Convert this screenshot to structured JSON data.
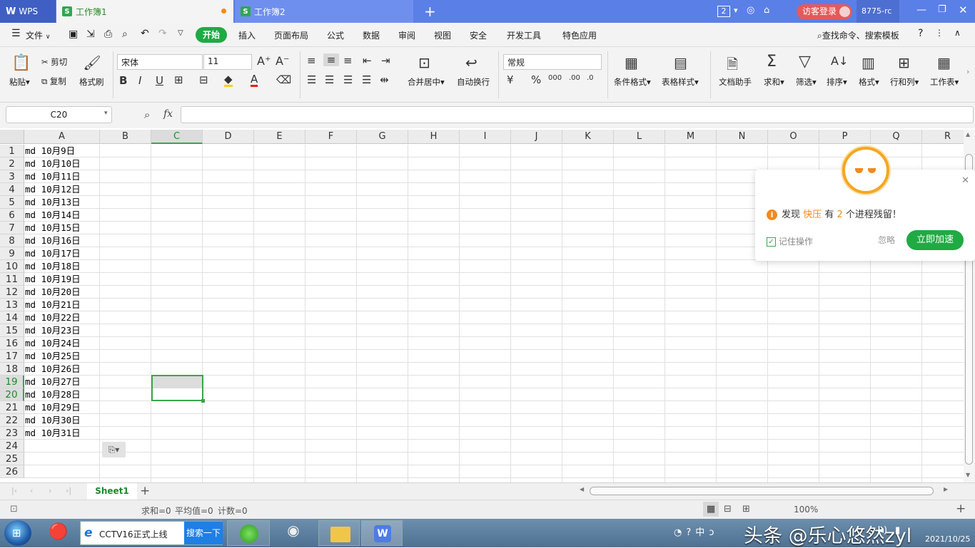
{
  "titlebar": {
    "tabs": [
      {
        "label": "WPS"
      },
      {
        "label": "工作簿1"
      },
      {
        "label": "工作簿2"
      }
    ],
    "badge": "2",
    "login_label": "访客登录",
    "user_id": "8775-rc"
  },
  "menu": {
    "file": "文件",
    "items": [
      "开始",
      "插入",
      "页面布局",
      "公式",
      "数据",
      "审阅",
      "视图",
      "安全",
      "开发工具",
      "特色应用"
    ],
    "search_label": "查找命令、搜索模板"
  },
  "ribbon": {
    "paste": "粘贴",
    "cut": "剪切",
    "copy": "复制",
    "format_painter": "格式刷",
    "font_name": "宋体",
    "font_size": "11",
    "merge_center": "合并居中",
    "wrap_text": "自动换行",
    "number_format": "常规",
    "cond_format": "条件格式",
    "table_style": "表格样式",
    "doc_helper": "文档助手",
    "sum": "求和",
    "filter": "筛选",
    "sort": "排序",
    "format": "格式",
    "rows_cols": "行和列",
    "worksheet": "工作表"
  },
  "formula_bar": {
    "name_box": "C20",
    "fx": "fx",
    "value": ""
  },
  "grid": {
    "columns": [
      "A",
      "B",
      "C",
      "D",
      "E",
      "F",
      "G",
      "H",
      "I",
      "J",
      "K",
      "L",
      "M",
      "N",
      "O",
      "P",
      "Q",
      "R"
    ],
    "rows": [
      "1",
      "2",
      "3",
      "4",
      "5",
      "6",
      "7",
      "8",
      "9",
      "10",
      "11",
      "12",
      "13",
      "14",
      "15",
      "16",
      "17",
      "18",
      "19",
      "20",
      "21",
      "22",
      "23",
      "24",
      "25",
      "26"
    ],
    "col_a": [
      "md 10月9日",
      "md 10月10日",
      "md 10月11日",
      "md 10月12日",
      "md 10月13日",
      "md 10月14日",
      "md 10月15日",
      "md 10月16日",
      "md 10月17日",
      "md 10月18日",
      "md 10月19日",
      "md 10月20日",
      "md 10月21日",
      "md 10月22日",
      "md 10月23日",
      "md 10月24日",
      "md 10月25日",
      "md 10月26日",
      "md 10月27日",
      "md 10月28日",
      "md 10月29日",
      "md 10月30日",
      "md 10月31日"
    ]
  },
  "popup": {
    "msg_prefix": "发现",
    "app_name": "快压",
    "msg_mid": "有",
    "count": "2",
    "msg_suffix": "个进程残留！",
    "remember": "记住操作",
    "ignore": "忽略",
    "accelerate": "立即加速"
  },
  "sheets": {
    "active": "Sheet1"
  },
  "status": {
    "sum": "求和=0",
    "avg": "平均值=0",
    "count": "计数=0",
    "zoom": "100%"
  },
  "taskbar": {
    "ie_label": "CCTV16正式上线",
    "search_btn": "搜索一下",
    "watermark": "头条 @乐心悠然zyl",
    "date": "2021/10/25"
  },
  "colors": {
    "title_blue": "#5a7fe6",
    "accent_green": "#1faa44",
    "popup_orange": "#f08a1c"
  }
}
